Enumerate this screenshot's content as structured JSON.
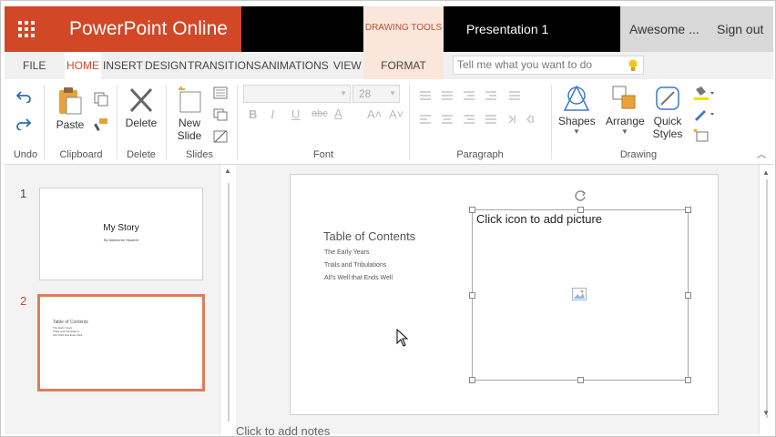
{
  "titlebar": {
    "app_name": "PowerPoint Online",
    "context_group": "DRAWING TOOLS",
    "document_title": "Presentation 1",
    "user_name": "Awesome ...",
    "sign_out": "Sign out"
  },
  "tabs": [
    {
      "label": "FILE"
    },
    {
      "label": "HOME"
    },
    {
      "label": "INSERT"
    },
    {
      "label": "DESIGN"
    },
    {
      "label": "TRANSITIONS"
    },
    {
      "label": "ANIMATIONS"
    },
    {
      "label": "VIEW"
    },
    {
      "label": "FORMAT"
    }
  ],
  "tell_me": {
    "placeholder": "Tell me what you want to do"
  },
  "ribbon": {
    "undo_group": "Undo",
    "clipboard": {
      "paste": "Paste",
      "label": "Clipboard"
    },
    "delete": {
      "button": "Delete",
      "label": "Delete"
    },
    "slides": {
      "new_slide_line1": "New",
      "new_slide_line2": "Slide",
      "label": "Slides"
    },
    "font": {
      "size": "28",
      "label": "Font",
      "bold": "B",
      "italic": "I",
      "underline": "U",
      "strike": "abc",
      "color": "A",
      "grow": "A˄",
      "shrink": "A˅"
    },
    "paragraph": {
      "label": "Paragraph"
    },
    "drawing": {
      "shapes": "Shapes",
      "arrange": "Arrange",
      "quick_styles_line1": "Quick",
      "quick_styles_line2": "Styles",
      "label": "Drawing"
    }
  },
  "thumbnails": [
    {
      "number": "1",
      "title": "My Story",
      "subtitle": "By Awesome Student"
    },
    {
      "number": "2",
      "title": "Table of Contents",
      "items": [
        "The Early Years",
        "Trials and Tribulations",
        "All's Well that Ends Well"
      ]
    }
  ],
  "slide": {
    "title": "Table of Contents",
    "items": [
      "The Early Years",
      "Trials and Tribulations",
      "All's Well that Ends Well"
    ],
    "placeholder_text": "Click icon to add picture"
  },
  "notes": {
    "placeholder": "Click to add notes"
  },
  "colors": {
    "brand": "#d24726",
    "context_tab": "#fbe6dc",
    "selected_thumb_border": "#e07b5a"
  }
}
